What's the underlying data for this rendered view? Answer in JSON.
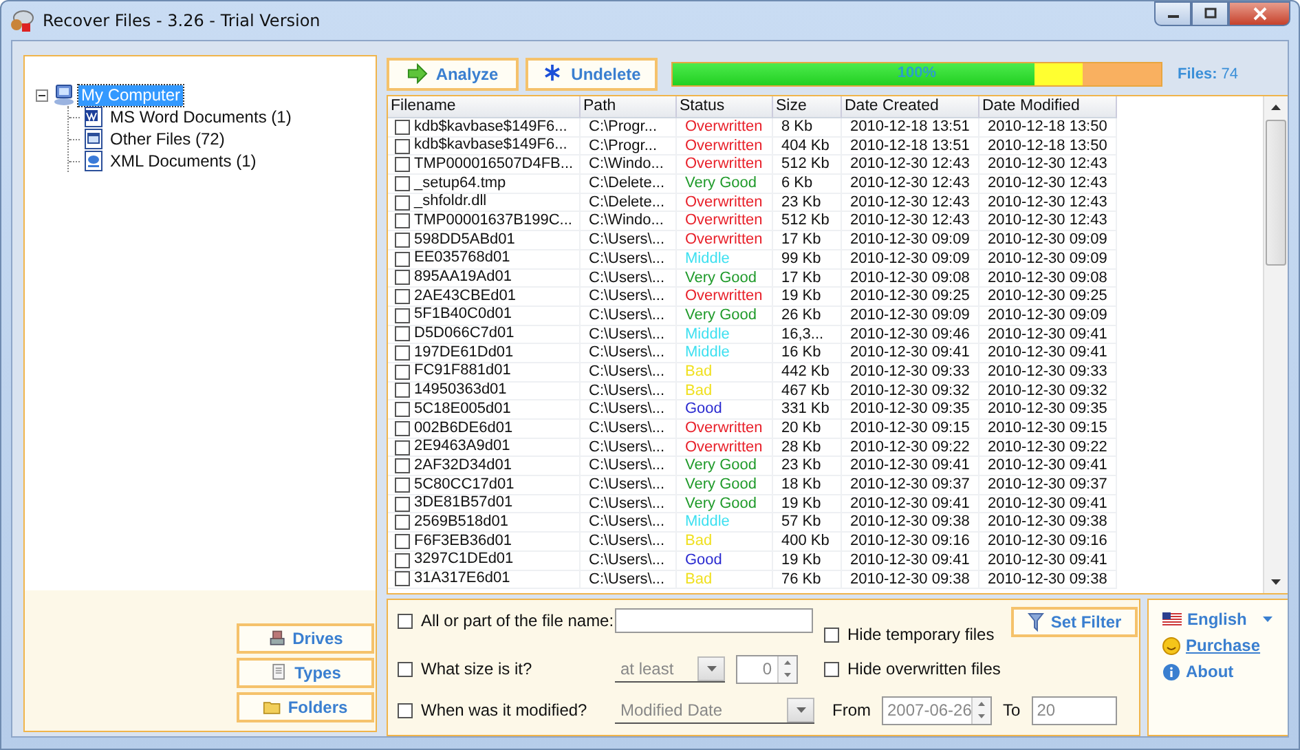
{
  "window": {
    "title": "Recover Files - 3.26 - Trial Version"
  },
  "tree": {
    "items": [
      {
        "label": "My Computer",
        "kind": "computer",
        "selected": true,
        "expanded": true,
        "children": [
          {
            "label": "MS Word Documents (1)",
            "kind": "word",
            "selected": false
          },
          {
            "label": "Other Files (72)",
            "kind": "other",
            "selected": false
          },
          {
            "label": "XML Documents (1)",
            "kind": "xml",
            "selected": false
          }
        ]
      }
    ]
  },
  "side_buttons": [
    {
      "label": "Drives",
      "kind": "drives"
    },
    {
      "label": "Types",
      "kind": "types"
    },
    {
      "label": "Folders",
      "kind": "folders"
    }
  ],
  "toolbar": {
    "buttons": [
      {
        "label": "Analyze",
        "kind": "analyze"
      },
      {
        "label": "Undelete",
        "kind": "undelete"
      }
    ],
    "progress": {
      "label": "100%",
      "level": 0.74
    },
    "files_label": "Files:",
    "files_count": "74"
  },
  "table": {
    "columns": [
      "Filename",
      "Path",
      "Status",
      "Size",
      "Date Created",
      "Date Modified"
    ],
    "rows": [
      {
        "checked": false,
        "filename": "kdb$kavbase$149F6...",
        "path": "C:\\Progr...",
        "status": "Overwritten",
        "color": "#e8202a",
        "size": "8 Kb",
        "created": "2010-12-18 13:51",
        "modified": "2010-12-18 13:50"
      },
      {
        "checked": false,
        "filename": "kdb$kavbase$149F6...",
        "path": "C:\\Progr...",
        "status": "Overwritten",
        "color": "#e8202a",
        "size": "404 Kb",
        "created": "2010-12-18 13:51",
        "modified": "2010-12-18 13:50"
      },
      {
        "checked": false,
        "filename": "TMP000016507D4FB...",
        "path": "C:\\Windo...",
        "status": "Overwritten",
        "color": "#e8202a",
        "size": "512 Kb",
        "created": "2010-12-30 12:43",
        "modified": "2010-12-30 12:43"
      },
      {
        "checked": false,
        "filename": "_setup64.tmp",
        "path": "C:\\Delete...",
        "status": "Very Good",
        "color": "#1f9a2a",
        "size": "6 Kb",
        "created": "2010-12-30 12:43",
        "modified": "2010-12-30 12:43"
      },
      {
        "checked": false,
        "filename": "_shfoldr.dll",
        "path": "C:\\Delete...",
        "status": "Overwritten",
        "color": "#e8202a",
        "size": "23 Kb",
        "created": "2010-12-30 12:43",
        "modified": "2010-12-30 12:43"
      },
      {
        "checked": false,
        "filename": "TMP00001637B199C...",
        "path": "C:\\Windo...",
        "status": "Overwritten",
        "color": "#e8202a",
        "size": "512 Kb",
        "created": "2010-12-30 12:43",
        "modified": "2010-12-30 12:43"
      },
      {
        "checked": false,
        "filename": "598DD5ABd01",
        "path": "C:\\Users\\...",
        "status": "Overwritten",
        "color": "#e8202a",
        "size": "17 Kb",
        "created": "2010-12-30 09:09",
        "modified": "2010-12-30 09:09"
      },
      {
        "checked": false,
        "filename": "EE035768d01",
        "path": "C:\\Users\\...",
        "status": "Middle",
        "color": "#3ee0f0",
        "size": "99 Kb",
        "created": "2010-12-30 09:09",
        "modified": "2010-12-30 09:09"
      },
      {
        "checked": false,
        "filename": "895AA19Ad01",
        "path": "C:\\Users\\...",
        "status": "Very Good",
        "color": "#1f9a2a",
        "size": "17 Kb",
        "created": "2010-12-30 09:08",
        "modified": "2010-12-30 09:08"
      },
      {
        "checked": false,
        "filename": "2AE43CBEd01",
        "path": "C:\\Users\\...",
        "status": "Overwritten",
        "color": "#e8202a",
        "size": "19 Kb",
        "created": "2010-12-30 09:25",
        "modified": "2010-12-30 09:25"
      },
      {
        "checked": false,
        "filename": "5F1B40C0d01",
        "path": "C:\\Users\\...",
        "status": "Very Good",
        "color": "#1f9a2a",
        "size": "26 Kb",
        "created": "2010-12-30 09:09",
        "modified": "2010-12-30 09:09"
      },
      {
        "checked": false,
        "filename": "D5D066C7d01",
        "path": "C:\\Users\\...",
        "status": "Middle",
        "color": "#3ee0f0",
        "size": "16,3...",
        "created": "2010-12-30 09:46",
        "modified": "2010-12-30 09:41"
      },
      {
        "checked": false,
        "filename": "197DE61Dd01",
        "path": "C:\\Users\\...",
        "status": "Middle",
        "color": "#3ee0f0",
        "size": "16 Kb",
        "created": "2010-12-30 09:41",
        "modified": "2010-12-30 09:41"
      },
      {
        "checked": false,
        "filename": "FC91F881d01",
        "path": "C:\\Users\\...",
        "status": "Bad",
        "color": "#f0e020",
        "size": "442 Kb",
        "created": "2010-12-30 09:33",
        "modified": "2010-12-30 09:33"
      },
      {
        "checked": false,
        "filename": "14950363d01",
        "path": "C:\\Users\\...",
        "status": "Bad",
        "color": "#f0e020",
        "size": "467 Kb",
        "created": "2010-12-30 09:32",
        "modified": "2010-12-30 09:32"
      },
      {
        "checked": false,
        "filename": "5C18E005d01",
        "path": "C:\\Users\\...",
        "status": "Good",
        "color": "#2a2ad0",
        "size": "331 Kb",
        "created": "2010-12-30 09:35",
        "modified": "2010-12-30 09:35"
      },
      {
        "checked": false,
        "filename": "002B6DE6d01",
        "path": "C:\\Users\\...",
        "status": "Overwritten",
        "color": "#e8202a",
        "size": "20 Kb",
        "created": "2010-12-30 09:15",
        "modified": "2010-12-30 09:15"
      },
      {
        "checked": false,
        "filename": "2E9463A9d01",
        "path": "C:\\Users\\...",
        "status": "Overwritten",
        "color": "#e8202a",
        "size": "28 Kb",
        "created": "2010-12-30 09:22",
        "modified": "2010-12-30 09:22"
      },
      {
        "checked": false,
        "filename": "2AF32D34d01",
        "path": "C:\\Users\\...",
        "status": "Very Good",
        "color": "#1f9a2a",
        "size": "23 Kb",
        "created": "2010-12-30 09:41",
        "modified": "2010-12-30 09:41"
      },
      {
        "checked": false,
        "filename": "5C80CC17d01",
        "path": "C:\\Users\\...",
        "status": "Very Good",
        "color": "#1f9a2a",
        "size": "18 Kb",
        "created": "2010-12-30 09:37",
        "modified": "2010-12-30 09:37"
      },
      {
        "checked": false,
        "filename": "3DE81B57d01",
        "path": "C:\\Users\\...",
        "status": "Very Good",
        "color": "#1f9a2a",
        "size": "19 Kb",
        "created": "2010-12-30 09:41",
        "modified": "2010-12-30 09:41"
      },
      {
        "checked": false,
        "filename": "2569B518d01",
        "path": "C:\\Users\\...",
        "status": "Middle",
        "color": "#3ee0f0",
        "size": "57 Kb",
        "created": "2010-12-30 09:38",
        "modified": "2010-12-30 09:38"
      },
      {
        "checked": false,
        "filename": "F6F3EB36d01",
        "path": "C:\\Users\\...",
        "status": "Bad",
        "color": "#f0e020",
        "size": "400 Kb",
        "created": "2010-12-30 09:16",
        "modified": "2010-12-30 09:16"
      },
      {
        "checked": false,
        "filename": "3297C1DEd01",
        "path": "C:\\Users\\...",
        "status": "Good",
        "color": "#2a2ad0",
        "size": "19 Kb",
        "created": "2010-12-30 09:41",
        "modified": "2010-12-30 09:41"
      },
      {
        "checked": false,
        "filename": "31A317E6d01",
        "path": "C:\\Users\\...",
        "status": "Bad",
        "color": "#f0e020",
        "size": "76 Kb",
        "created": "2010-12-30 09:38",
        "modified": "2010-12-30 09:38"
      }
    ]
  },
  "filter": {
    "name": {
      "label": "All or part of the file name:",
      "checked": false
    },
    "size": {
      "label": "What size is it?",
      "checked": false,
      "mode": "at least",
      "value": "0"
    },
    "modified": {
      "label": "When was it modified?",
      "checked": false,
      "mode": "Modified Date",
      "from_label": "From",
      "from": "2007-06-26",
      "to_label": "To",
      "to": "20"
    },
    "hide_temporary": {
      "label": "Hide temporary files",
      "checked": false
    },
    "hide_overwritten": {
      "label": "Hide overwritten files",
      "checked": false
    },
    "set_filter": "Set Filter"
  },
  "links": {
    "language": "English",
    "purchase": "Purchase",
    "about": "About"
  }
}
